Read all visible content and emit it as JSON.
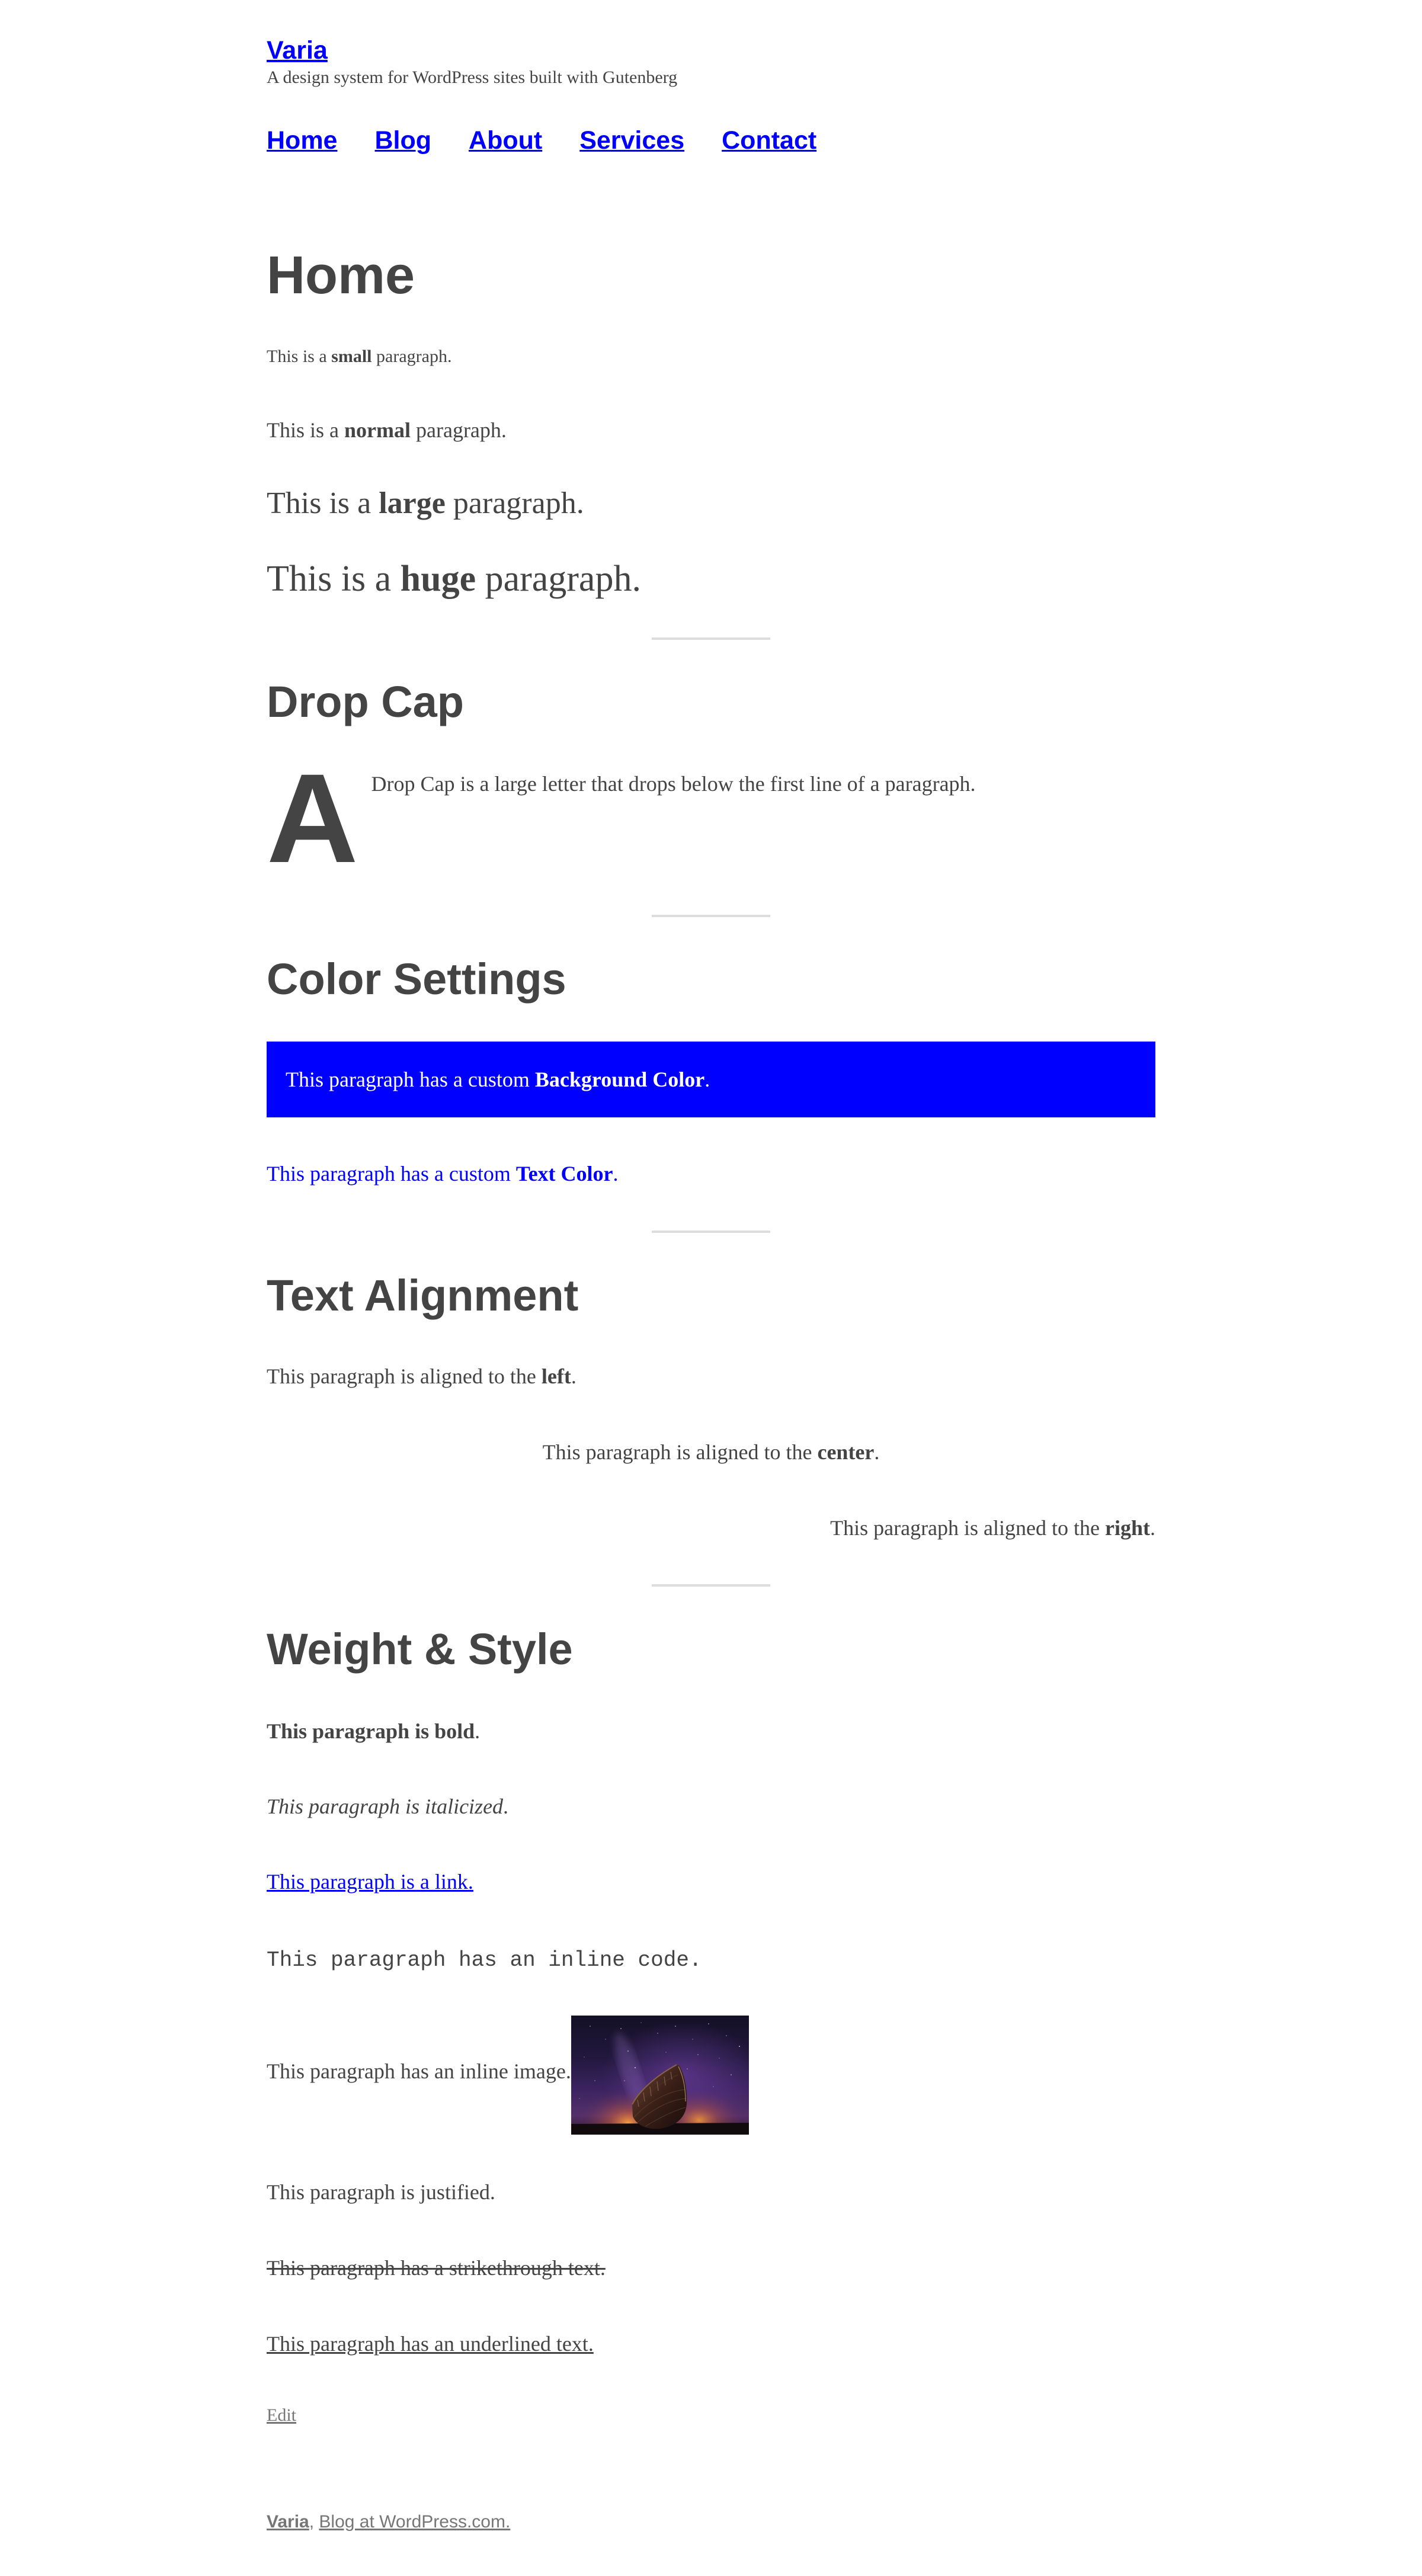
{
  "site": {
    "title": "Varia",
    "tagline": "A design system for WordPress sites built with Gutenberg"
  },
  "nav": {
    "items": [
      {
        "label": "Home"
      },
      {
        "label": "Blog"
      },
      {
        "label": "About"
      },
      {
        "label": "Services"
      },
      {
        "label": "Contact"
      }
    ]
  },
  "page": {
    "title": "Home"
  },
  "font_sizes": {
    "small": {
      "pre": "This is a ",
      "strong": "small",
      "post": " paragraph."
    },
    "normal": {
      "pre": "This is a ",
      "strong": "normal",
      "post": " paragraph."
    },
    "large": {
      "pre": "This is a ",
      "strong": "large",
      "post": " paragraph."
    },
    "huge": {
      "pre": "This is a ",
      "strong": "huge",
      "post": " paragraph."
    }
  },
  "drop_cap": {
    "heading": "Drop Cap",
    "letter": "A",
    "text": "Drop Cap is a large letter that drops below the first line of a paragraph."
  },
  "color_settings": {
    "heading": "Color Settings",
    "background_paragraph": {
      "pre": "This paragraph has a custom ",
      "strong": "Background Color",
      "post": ".",
      "background_color": "#0000ff",
      "text_color": "#ffffff"
    },
    "text_paragraph": {
      "pre": "This paragraph has a custom ",
      "strong": "Text Color",
      "post": ".",
      "text_color": "#0000ff"
    }
  },
  "text_alignment": {
    "heading": "Text Alignment",
    "paragraphs": [
      {
        "pre": "This paragraph is aligned to the ",
        "strong": "left",
        "post": "."
      },
      {
        "pre": "This paragraph is aligned to the ",
        "strong": "center",
        "post": "."
      },
      {
        "pre": "This paragraph is aligned to the ",
        "strong": "right",
        "post": "."
      }
    ]
  },
  "weight_style": {
    "heading": "Weight & Style",
    "bold": {
      "strong": "This paragraph is bold",
      "post": "."
    },
    "italic": {
      "em": "This paragraph is italicized",
      "post": "."
    },
    "link": "This paragraph is a link.",
    "code": "This paragraph has an inline code.",
    "image_text": "This paragraph has an inline image.",
    "justified": "This paragraph is justified.",
    "strikethrough": "This paragraph has a strikethrough text.",
    "underline": "This paragraph has an underlined text."
  },
  "edit_link": "Edit",
  "footer": {
    "site_name": "Varia",
    "separator": ", ",
    "credit": "Blog at WordPress.com."
  },
  "colors": {
    "text": "#444444",
    "link": "#0000ff",
    "muted": "#767676",
    "separator": "#dddddd",
    "background": "#ffffff"
  }
}
